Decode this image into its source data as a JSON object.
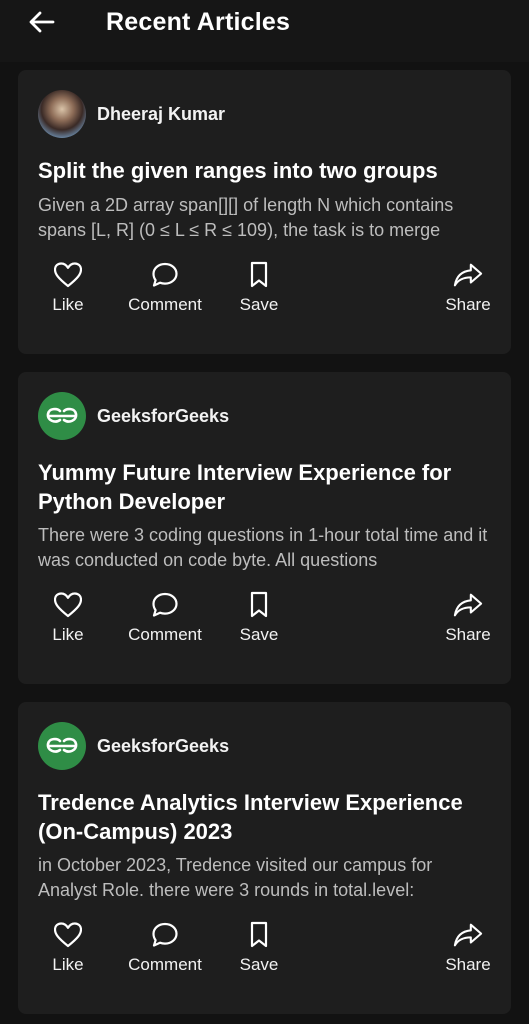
{
  "header": {
    "title": "Recent Articles",
    "back_icon": "arrow-left-icon"
  },
  "actions": {
    "like": "Like",
    "comment": "Comment",
    "save": "Save",
    "share": "Share"
  },
  "articles": [
    {
      "author": "Dheeraj Kumar",
      "avatar": "user-photo",
      "title": "Split the given ranges into two groups",
      "excerpt": "Given a 2D array span[][] of length N which contains spans [L, R] (0 ≤ L ≤ R ≤ 109), the task is to merge"
    },
    {
      "author": "GeeksforGeeks",
      "avatar": "gfg-logo",
      "title": "Yummy Future Interview Experience for Python Developer",
      "excerpt": "There were 3 coding questions in 1-hour total time and it was conducted on code byte. All questions"
    },
    {
      "author": "GeeksforGeeks",
      "avatar": "gfg-logo",
      "title": "Tredence Analytics Interview Experience (On-Campus) 2023",
      "excerpt": "in October 2023, Tredence visited our campus for Analyst Role. there were 3 rounds in total.level:"
    }
  ],
  "colors": {
    "background": "#121212",
    "card": "#1e1e1e",
    "gfg_green": "#2f8d46",
    "text_secondary": "#bdbdbd"
  }
}
